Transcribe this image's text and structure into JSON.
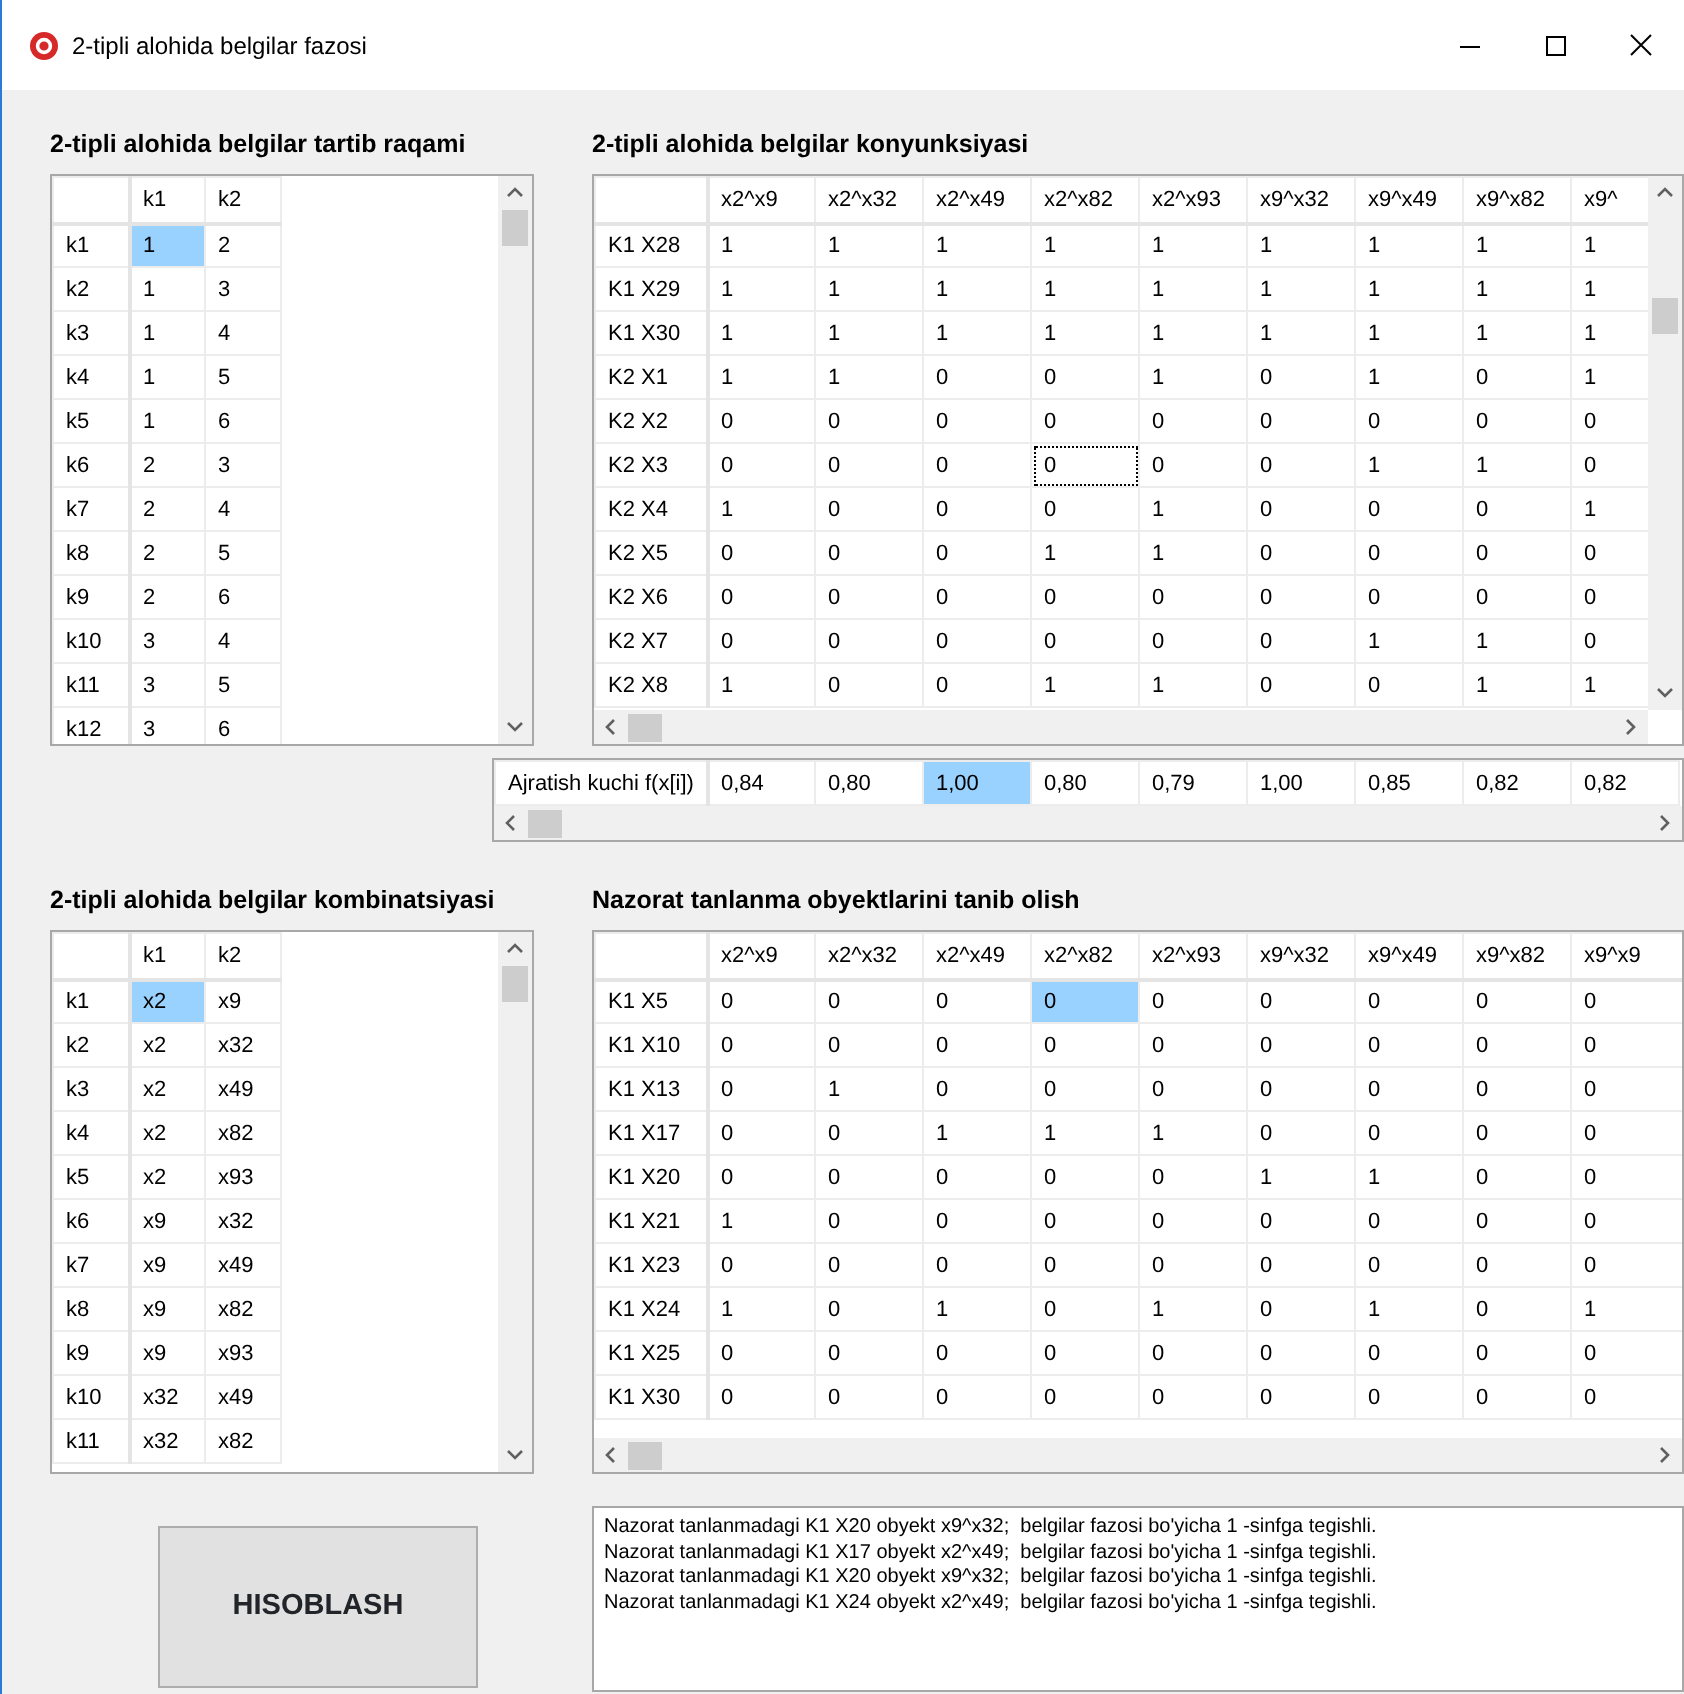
{
  "window": {
    "title": "2-tipli alohida belgilar fazosi"
  },
  "order_table": {
    "title": "2-tipli alohida belgilar tartib raqami",
    "columns": [
      "k1",
      "k2"
    ],
    "rows": [
      {
        "header": "k1",
        "cells": [
          {
            "text": "1",
            "selected": true
          },
          {
            "text": "2",
            "selected": false
          }
        ]
      },
      {
        "header": "k2",
        "cells": [
          {
            "text": "1",
            "selected": false
          },
          {
            "text": "3",
            "selected": false
          }
        ]
      },
      {
        "header": "k3",
        "cells": [
          {
            "text": "1",
            "selected": false
          },
          {
            "text": "4",
            "selected": false
          }
        ]
      },
      {
        "header": "k4",
        "cells": [
          {
            "text": "1",
            "selected": false
          },
          {
            "text": "5",
            "selected": false
          }
        ]
      },
      {
        "header": "k5",
        "cells": [
          {
            "text": "1",
            "selected": false
          },
          {
            "text": "6",
            "selected": false
          }
        ]
      },
      {
        "header": "k6",
        "cells": [
          {
            "text": "2",
            "selected": false
          },
          {
            "text": "3",
            "selected": false
          }
        ]
      },
      {
        "header": "k7",
        "cells": [
          {
            "text": "2",
            "selected": false
          },
          {
            "text": "4",
            "selected": false
          }
        ]
      },
      {
        "header": "k8",
        "cells": [
          {
            "text": "2",
            "selected": false
          },
          {
            "text": "5",
            "selected": false
          }
        ]
      },
      {
        "header": "k9",
        "cells": [
          {
            "text": "2",
            "selected": false
          },
          {
            "text": "6",
            "selected": false
          }
        ]
      },
      {
        "header": "k10",
        "cells": [
          {
            "text": "3",
            "selected": false
          },
          {
            "text": "4",
            "selected": false
          }
        ]
      },
      {
        "header": "k11",
        "cells": [
          {
            "text": "3",
            "selected": false
          },
          {
            "text": "5",
            "selected": false
          }
        ]
      },
      {
        "header": "k12",
        "cells": [
          {
            "text": "3",
            "selected": false
          },
          {
            "text": "6",
            "selected": false
          }
        ]
      }
    ]
  },
  "conjunction_table": {
    "title": "2-tipli alohida belgilar konyunksiyasi",
    "columns": [
      "x2^x9",
      "x2^x32",
      "x2^x49",
      "x2^x82",
      "x2^x93",
      "x9^x32",
      "x9^x49",
      "x9^x82",
      "x9^"
    ],
    "rows": [
      {
        "header": "K1 X28",
        "cells": [
          {
            "text": "1",
            "selected": false,
            "focused": false
          },
          {
            "text": "1",
            "selected": false,
            "focused": false
          },
          {
            "text": "1",
            "selected": false,
            "focused": false
          },
          {
            "text": "1",
            "selected": false,
            "focused": false
          },
          {
            "text": "1",
            "selected": false,
            "focused": false
          },
          {
            "text": "1",
            "selected": false,
            "focused": false
          },
          {
            "text": "1",
            "selected": false,
            "focused": false
          },
          {
            "text": "1",
            "selected": false,
            "focused": false
          },
          {
            "text": "1",
            "selected": false,
            "focused": false
          }
        ]
      },
      {
        "header": "K1 X29",
        "cells": [
          {
            "text": "1",
            "selected": false,
            "focused": false
          },
          {
            "text": "1",
            "selected": false,
            "focused": false
          },
          {
            "text": "1",
            "selected": false,
            "focused": false
          },
          {
            "text": "1",
            "selected": false,
            "focused": false
          },
          {
            "text": "1",
            "selected": false,
            "focused": false
          },
          {
            "text": "1",
            "selected": false,
            "focused": false
          },
          {
            "text": "1",
            "selected": false,
            "focused": false
          },
          {
            "text": "1",
            "selected": false,
            "focused": false
          },
          {
            "text": "1",
            "selected": false,
            "focused": false
          }
        ]
      },
      {
        "header": "K1 X30",
        "cells": [
          {
            "text": "1",
            "selected": false,
            "focused": false
          },
          {
            "text": "1",
            "selected": false,
            "focused": false
          },
          {
            "text": "1",
            "selected": false,
            "focused": false
          },
          {
            "text": "1",
            "selected": false,
            "focused": false
          },
          {
            "text": "1",
            "selected": false,
            "focused": false
          },
          {
            "text": "1",
            "selected": false,
            "focused": false
          },
          {
            "text": "1",
            "selected": false,
            "focused": false
          },
          {
            "text": "1",
            "selected": false,
            "focused": false
          },
          {
            "text": "1",
            "selected": false,
            "focused": false
          }
        ]
      },
      {
        "header": "K2 X1",
        "cells": [
          {
            "text": "1",
            "selected": false,
            "focused": false
          },
          {
            "text": "1",
            "selected": false,
            "focused": false
          },
          {
            "text": "0",
            "selected": false,
            "focused": false
          },
          {
            "text": "0",
            "selected": false,
            "focused": false
          },
          {
            "text": "1",
            "selected": false,
            "focused": false
          },
          {
            "text": "0",
            "selected": false,
            "focused": false
          },
          {
            "text": "1",
            "selected": false,
            "focused": false
          },
          {
            "text": "0",
            "selected": false,
            "focused": false
          },
          {
            "text": "1",
            "selected": false,
            "focused": false
          }
        ]
      },
      {
        "header": "K2 X2",
        "cells": [
          {
            "text": "0",
            "selected": false,
            "focused": false
          },
          {
            "text": "0",
            "selected": false,
            "focused": false
          },
          {
            "text": "0",
            "selected": false,
            "focused": false
          },
          {
            "text": "0",
            "selected": false,
            "focused": false
          },
          {
            "text": "0",
            "selected": false,
            "focused": false
          },
          {
            "text": "0",
            "selected": false,
            "focused": false
          },
          {
            "text": "0",
            "selected": false,
            "focused": false
          },
          {
            "text": "0",
            "selected": false,
            "focused": false
          },
          {
            "text": "0",
            "selected": false,
            "focused": false
          }
        ]
      },
      {
        "header": "K2 X3",
        "cells": [
          {
            "text": "0",
            "selected": false,
            "focused": false
          },
          {
            "text": "0",
            "selected": false,
            "focused": false
          },
          {
            "text": "0",
            "selected": false,
            "focused": false
          },
          {
            "text": "0",
            "selected": false,
            "focused": true
          },
          {
            "text": "0",
            "selected": false,
            "focused": false
          },
          {
            "text": "0",
            "selected": false,
            "focused": false
          },
          {
            "text": "1",
            "selected": false,
            "focused": false
          },
          {
            "text": "1",
            "selected": false,
            "focused": false
          },
          {
            "text": "0",
            "selected": false,
            "focused": false
          }
        ]
      },
      {
        "header": "K2 X4",
        "cells": [
          {
            "text": "1",
            "selected": false,
            "focused": false
          },
          {
            "text": "0",
            "selected": false,
            "focused": false
          },
          {
            "text": "0",
            "selected": false,
            "focused": false
          },
          {
            "text": "0",
            "selected": false,
            "focused": false
          },
          {
            "text": "1",
            "selected": false,
            "focused": false
          },
          {
            "text": "0",
            "selected": false,
            "focused": false
          },
          {
            "text": "0",
            "selected": false,
            "focused": false
          },
          {
            "text": "0",
            "selected": false,
            "focused": false
          },
          {
            "text": "1",
            "selected": false,
            "focused": false
          }
        ]
      },
      {
        "header": "K2 X5",
        "cells": [
          {
            "text": "0",
            "selected": false,
            "focused": false
          },
          {
            "text": "0",
            "selected": false,
            "focused": false
          },
          {
            "text": "0",
            "selected": false,
            "focused": false
          },
          {
            "text": "1",
            "selected": false,
            "focused": false
          },
          {
            "text": "1",
            "selected": false,
            "focused": false
          },
          {
            "text": "0",
            "selected": false,
            "focused": false
          },
          {
            "text": "0",
            "selected": false,
            "focused": false
          },
          {
            "text": "0",
            "selected": false,
            "focused": false
          },
          {
            "text": "0",
            "selected": false,
            "focused": false
          }
        ]
      },
      {
        "header": "K2 X6",
        "cells": [
          {
            "text": "0",
            "selected": false,
            "focused": false
          },
          {
            "text": "0",
            "selected": false,
            "focused": false
          },
          {
            "text": "0",
            "selected": false,
            "focused": false
          },
          {
            "text": "0",
            "selected": false,
            "focused": false
          },
          {
            "text": "0",
            "selected": false,
            "focused": false
          },
          {
            "text": "0",
            "selected": false,
            "focused": false
          },
          {
            "text": "0",
            "selected": false,
            "focused": false
          },
          {
            "text": "0",
            "selected": false,
            "focused": false
          },
          {
            "text": "0",
            "selected": false,
            "focused": false
          }
        ]
      },
      {
        "header": "K2 X7",
        "cells": [
          {
            "text": "0",
            "selected": false,
            "focused": false
          },
          {
            "text": "0",
            "selected": false,
            "focused": false
          },
          {
            "text": "0",
            "selected": false,
            "focused": false
          },
          {
            "text": "0",
            "selected": false,
            "focused": false
          },
          {
            "text": "0",
            "selected": false,
            "focused": false
          },
          {
            "text": "0",
            "selected": false,
            "focused": false
          },
          {
            "text": "1",
            "selected": false,
            "focused": false
          },
          {
            "text": "1",
            "selected": false,
            "focused": false
          },
          {
            "text": "0",
            "selected": false,
            "focused": false
          }
        ]
      },
      {
        "header": "K2 X8",
        "cells": [
          {
            "text": "1",
            "selected": false,
            "focused": false
          },
          {
            "text": "0",
            "selected": false,
            "focused": false
          },
          {
            "text": "0",
            "selected": false,
            "focused": false
          },
          {
            "text": "1",
            "selected": false,
            "focused": false
          },
          {
            "text": "1",
            "selected": false,
            "focused": false
          },
          {
            "text": "0",
            "selected": false,
            "focused": false
          },
          {
            "text": "0",
            "selected": false,
            "focused": false
          },
          {
            "text": "1",
            "selected": false,
            "focused": false
          },
          {
            "text": "1",
            "selected": false,
            "focused": false
          }
        ]
      }
    ]
  },
  "separation_row": {
    "label": "Ajratish kuchi f(x[i])",
    "cells": [
      {
        "text": "0,84",
        "selected": false
      },
      {
        "text": "0,80",
        "selected": false
      },
      {
        "text": "1,00",
        "selected": true
      },
      {
        "text": "0,80",
        "selected": false
      },
      {
        "text": "0,79",
        "selected": false
      },
      {
        "text": "1,00",
        "selected": false
      },
      {
        "text": "0,85",
        "selected": false
      },
      {
        "text": "0,82",
        "selected": false
      },
      {
        "text": "0,82",
        "selected": false
      }
    ]
  },
  "combination_table": {
    "title": "2-tipli alohida belgilar kombinatsiyasi",
    "columns": [
      "k1",
      "k2"
    ],
    "rows": [
      {
        "header": "k1",
        "cells": [
          {
            "text": "x2",
            "selected": true
          },
          {
            "text": "x9",
            "selected": false
          }
        ]
      },
      {
        "header": "k2",
        "cells": [
          {
            "text": "x2",
            "selected": false
          },
          {
            "text": "x32",
            "selected": false
          }
        ]
      },
      {
        "header": "k3",
        "cells": [
          {
            "text": "x2",
            "selected": false
          },
          {
            "text": "x49",
            "selected": false
          }
        ]
      },
      {
        "header": "k4",
        "cells": [
          {
            "text": "x2",
            "selected": false
          },
          {
            "text": "x82",
            "selected": false
          }
        ]
      },
      {
        "header": "k5",
        "cells": [
          {
            "text": "x2",
            "selected": false
          },
          {
            "text": "x93",
            "selected": false
          }
        ]
      },
      {
        "header": "k6",
        "cells": [
          {
            "text": "x9",
            "selected": false
          },
          {
            "text": "x32",
            "selected": false
          }
        ]
      },
      {
        "header": "k7",
        "cells": [
          {
            "text": "x9",
            "selected": false
          },
          {
            "text": "x49",
            "selected": false
          }
        ]
      },
      {
        "header": "k8",
        "cells": [
          {
            "text": "x9",
            "selected": false
          },
          {
            "text": "x82",
            "selected": false
          }
        ]
      },
      {
        "header": "k9",
        "cells": [
          {
            "text": "x9",
            "selected": false
          },
          {
            "text": "x93",
            "selected": false
          }
        ]
      },
      {
        "header": "k10",
        "cells": [
          {
            "text": "x32",
            "selected": false
          },
          {
            "text": "x49",
            "selected": false
          }
        ]
      },
      {
        "header": "k11",
        "cells": [
          {
            "text": "x32",
            "selected": false
          },
          {
            "text": "x82",
            "selected": false
          }
        ]
      }
    ]
  },
  "recognition_table": {
    "title": "Nazorat tanlanma obyektlarini tanib olish",
    "columns": [
      "x2^x9",
      "x2^x32",
      "x2^x49",
      "x2^x82",
      "x2^x93",
      "x9^x32",
      "x9^x49",
      "x9^x82",
      "x9^x9"
    ],
    "rows": [
      {
        "header": "K1 X5",
        "cells": [
          {
            "text": "0",
            "selected": false
          },
          {
            "text": "0",
            "selected": false
          },
          {
            "text": "0",
            "selected": false
          },
          {
            "text": "0",
            "selected": true
          },
          {
            "text": "0",
            "selected": false
          },
          {
            "text": "0",
            "selected": false
          },
          {
            "text": "0",
            "selected": false
          },
          {
            "text": "0",
            "selected": false
          },
          {
            "text": "0",
            "selected": false
          }
        ]
      },
      {
        "header": "K1 X10",
        "cells": [
          {
            "text": "0",
            "selected": false
          },
          {
            "text": "0",
            "selected": false
          },
          {
            "text": "0",
            "selected": false
          },
          {
            "text": "0",
            "selected": false
          },
          {
            "text": "0",
            "selected": false
          },
          {
            "text": "0",
            "selected": false
          },
          {
            "text": "0",
            "selected": false
          },
          {
            "text": "0",
            "selected": false
          },
          {
            "text": "0",
            "selected": false
          }
        ]
      },
      {
        "header": "K1 X13",
        "cells": [
          {
            "text": "0",
            "selected": false
          },
          {
            "text": "1",
            "selected": false
          },
          {
            "text": "0",
            "selected": false
          },
          {
            "text": "0",
            "selected": false
          },
          {
            "text": "0",
            "selected": false
          },
          {
            "text": "0",
            "selected": false
          },
          {
            "text": "0",
            "selected": false
          },
          {
            "text": "0",
            "selected": false
          },
          {
            "text": "0",
            "selected": false
          }
        ]
      },
      {
        "header": "K1 X17",
        "cells": [
          {
            "text": "0",
            "selected": false
          },
          {
            "text": "0",
            "selected": false
          },
          {
            "text": "1",
            "selected": false
          },
          {
            "text": "1",
            "selected": false
          },
          {
            "text": "1",
            "selected": false
          },
          {
            "text": "0",
            "selected": false
          },
          {
            "text": "0",
            "selected": false
          },
          {
            "text": "0",
            "selected": false
          },
          {
            "text": "0",
            "selected": false
          }
        ]
      },
      {
        "header": "K1 X20",
        "cells": [
          {
            "text": "0",
            "selected": false
          },
          {
            "text": "0",
            "selected": false
          },
          {
            "text": "0",
            "selected": false
          },
          {
            "text": "0",
            "selected": false
          },
          {
            "text": "0",
            "selected": false
          },
          {
            "text": "1",
            "selected": false
          },
          {
            "text": "1",
            "selected": false
          },
          {
            "text": "0",
            "selected": false
          },
          {
            "text": "0",
            "selected": false
          }
        ]
      },
      {
        "header": "K1 X21",
        "cells": [
          {
            "text": "1",
            "selected": false
          },
          {
            "text": "0",
            "selected": false
          },
          {
            "text": "0",
            "selected": false
          },
          {
            "text": "0",
            "selected": false
          },
          {
            "text": "0",
            "selected": false
          },
          {
            "text": "0",
            "selected": false
          },
          {
            "text": "0",
            "selected": false
          },
          {
            "text": "0",
            "selected": false
          },
          {
            "text": "0",
            "selected": false
          }
        ]
      },
      {
        "header": "K1 X23",
        "cells": [
          {
            "text": "0",
            "selected": false
          },
          {
            "text": "0",
            "selected": false
          },
          {
            "text": "0",
            "selected": false
          },
          {
            "text": "0",
            "selected": false
          },
          {
            "text": "0",
            "selected": false
          },
          {
            "text": "0",
            "selected": false
          },
          {
            "text": "0",
            "selected": false
          },
          {
            "text": "0",
            "selected": false
          },
          {
            "text": "0",
            "selected": false
          }
        ]
      },
      {
        "header": "K1 X24",
        "cells": [
          {
            "text": "1",
            "selected": false
          },
          {
            "text": "0",
            "selected": false
          },
          {
            "text": "1",
            "selected": false
          },
          {
            "text": "0",
            "selected": false
          },
          {
            "text": "1",
            "selected": false
          },
          {
            "text": "0",
            "selected": false
          },
          {
            "text": "1",
            "selected": false
          },
          {
            "text": "0",
            "selected": false
          },
          {
            "text": "1",
            "selected": false
          }
        ]
      },
      {
        "header": "K1 X25",
        "cells": [
          {
            "text": "0",
            "selected": false
          },
          {
            "text": "0",
            "selected": false
          },
          {
            "text": "0",
            "selected": false
          },
          {
            "text": "0",
            "selected": false
          },
          {
            "text": "0",
            "selected": false
          },
          {
            "text": "0",
            "selected": false
          },
          {
            "text": "0",
            "selected": false
          },
          {
            "text": "0",
            "selected": false
          },
          {
            "text": "0",
            "selected": false
          }
        ]
      },
      {
        "header": "K1 X30",
        "cells": [
          {
            "text": "0",
            "selected": false
          },
          {
            "text": "0",
            "selected": false
          },
          {
            "text": "0",
            "selected": false
          },
          {
            "text": "0",
            "selected": false
          },
          {
            "text": "0",
            "selected": false
          },
          {
            "text": "0",
            "selected": false
          },
          {
            "text": "0",
            "selected": false
          },
          {
            "text": "0",
            "selected": false
          },
          {
            "text": "0",
            "selected": false
          }
        ]
      }
    ]
  },
  "calculate_button": {
    "label": "HISOBLASH"
  },
  "log": [
    "Nazorat tanlanmadagi K1 X20 obyekt x9^x32;  belgilar fazosi bo'yicha 1 -sinfga tegishli.",
    "Nazorat tanlanmadagi K1 X17 obyekt x2^x49;  belgilar fazosi bo'yicha 1 -sinfga tegishli.",
    "Nazorat tanlanmadagi K1 X20 obyekt x9^x32;  belgilar fazosi bo'yicha 1 -sinfga tegishli.",
    "Nazorat tanlanmadagi K1 X24 obyekt x2^x49;  belgilar fazosi bo'yicha 1 -sinfga tegishli."
  ]
}
